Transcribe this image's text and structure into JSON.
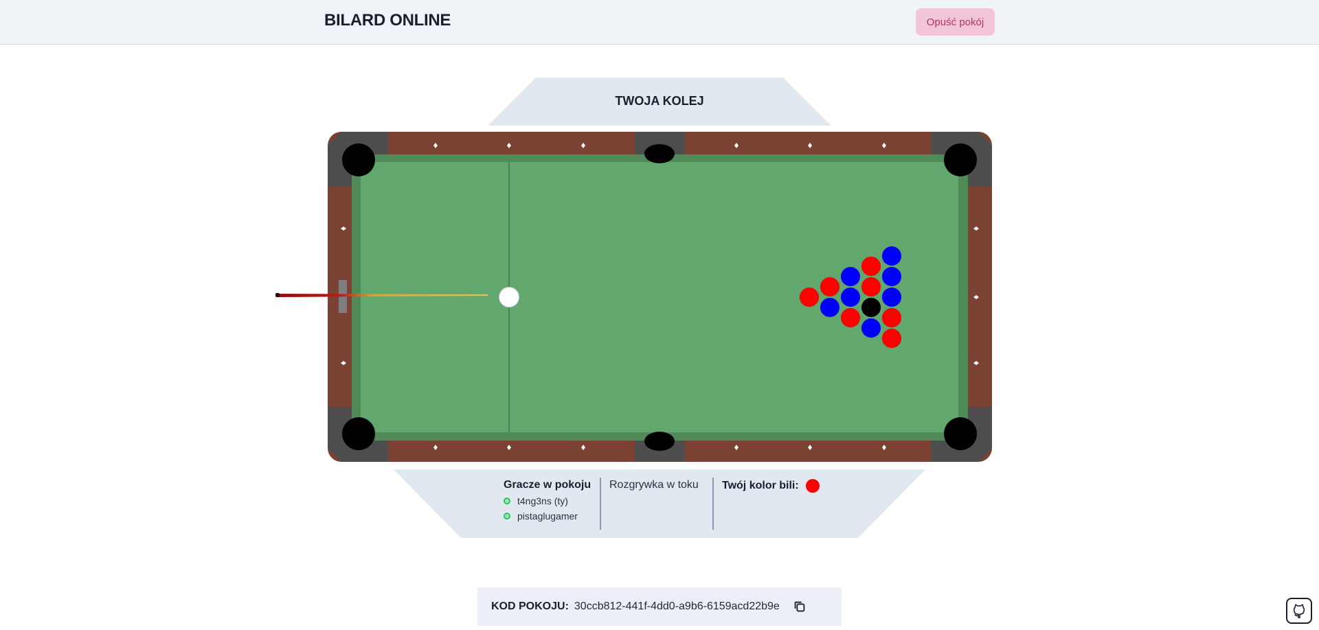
{
  "header": {
    "title": "BILARD ONLINE",
    "leave_button": "Opuść pokój"
  },
  "turn": {
    "label": "TWOJA KOLEJ"
  },
  "info": {
    "players_title": "Gracze w pokoju",
    "players": [
      "t4ng3ns (ty)",
      "pistaglugamer"
    ],
    "game_status": "Rozgrywka w toku",
    "color_label": "Twój kolor bili:",
    "player_ball_color": "#ff0000"
  },
  "room": {
    "code_label": "KOD POKOJU:",
    "code_value": "30ccb812-441f-4dd0-a9b6-6159acd22b9e"
  },
  "colors": {
    "felt": "#62a76e",
    "rail": "#7b4133",
    "pocket_frame": "#4d4d4d",
    "red_ball": "#ff0000",
    "blue_ball": "#0000ff",
    "black_ball": "#000000",
    "cue_ball": "#ffffff"
  },
  "icons": {
    "copy": "copy-icon",
    "github": "github-icon"
  }
}
